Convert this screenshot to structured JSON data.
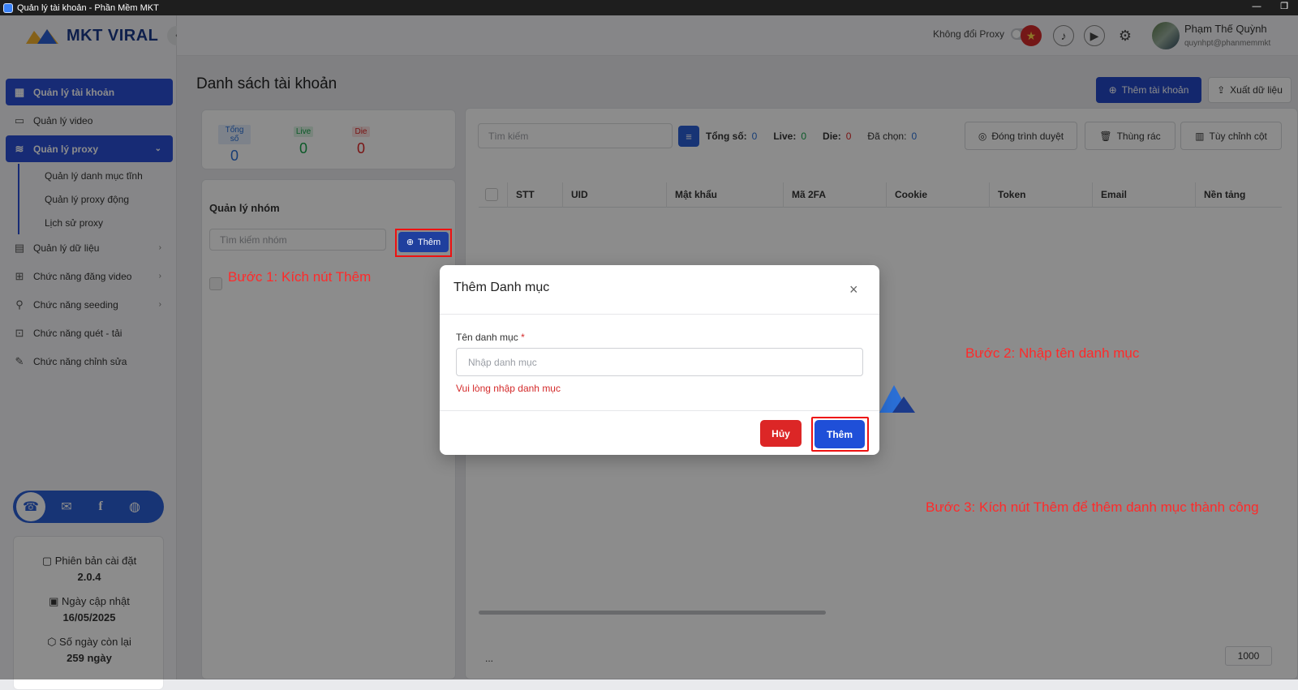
{
  "window": {
    "title": "Quản lý tài khoản - Phần Mềm MKT"
  },
  "logo": {
    "text": "MKT VIRAL"
  },
  "sidebar": {
    "items": [
      {
        "label": "Quản lý tài khoản",
        "icon": "dashboard-icon",
        "active": true
      },
      {
        "label": "Quản lý video",
        "icon": "video-icon",
        "active": false
      },
      {
        "label": "Quản lý proxy",
        "icon": "layers-icon",
        "active": true
      },
      {
        "label": "Quản lý dữ liệu",
        "icon": "data-icon",
        "active": false
      },
      {
        "label": "Chức năng đăng video",
        "icon": "upload-video-icon",
        "active": false
      },
      {
        "label": "Chức năng seeding",
        "icon": "seeding-icon",
        "active": false
      },
      {
        "label": "Chức năng quét - tải",
        "icon": "scan-download-icon",
        "active": false
      },
      {
        "label": "Chức năng chỉnh sửa",
        "icon": "edit-icon",
        "active": false
      }
    ],
    "proxy_sub": [
      "Quản lý danh mục tĩnh",
      "Quản lý proxy động",
      "Lịch sử proxy"
    ]
  },
  "info": {
    "version_label": "Phiên bản cài đặt",
    "version": "2.0.4",
    "update_label": "Ngày cập nhật",
    "update_date": "16/05/2025",
    "days_label": "Số ngày còn lại",
    "days_left": "259 ngày"
  },
  "header": {
    "proxy_label": "Không đổi Proxy",
    "user_name": "Phạm Thế Quỳnh",
    "user_email": "quynhpt@phanmemmkt"
  },
  "main": {
    "page_title": "Danh sách tài khoản",
    "add_account": "Thêm tài khoản",
    "export": "Xuất dữ liệu",
    "stats": [
      {
        "label": "Tổng số",
        "value": "0",
        "color": "#2a6fd6"
      },
      {
        "label": "Live",
        "value": "0",
        "color": "#16a34a"
      },
      {
        "label": "Die",
        "value": "0",
        "color": "#dc2626"
      }
    ],
    "group_title": "Quản lý nhóm",
    "group_search_placeholder": "Tìm kiếm nhóm",
    "group_add": "Thêm",
    "search_placeholder": "Tìm kiếm",
    "summary": {
      "total_label": "Tổng số:",
      "total": "0",
      "live_label": "Live:",
      "live": "0",
      "die_label": "Die:",
      "die": "0",
      "selected_label": "Đã chọn:",
      "selected": "0"
    },
    "close_browser": "Đóng trình duyệt",
    "trash": "Thùng rác",
    "customize_columns": "Tùy chỉnh cột",
    "columns": [
      "STT",
      "UID",
      "Mật khẩu",
      "Mã 2FA",
      "Cookie",
      "Token",
      "Email",
      "Nền tảng"
    ],
    "page_size": "1000",
    "ellipsis": "..."
  },
  "modal": {
    "title": "Thêm Danh mục",
    "field_label": "Tên danh mục",
    "required_mark": "*",
    "placeholder": "Nhập danh mục",
    "error": "Vui lòng nhập danh mục",
    "cancel": "Hủy",
    "submit": "Thêm"
  },
  "annotations": {
    "step1": "Bước 1: Kích nút Thêm",
    "step2": "Bước 2: Nhập tên danh mục",
    "step3": "Bước 3: Kích nút Thêm để thêm danh mục thành công"
  }
}
